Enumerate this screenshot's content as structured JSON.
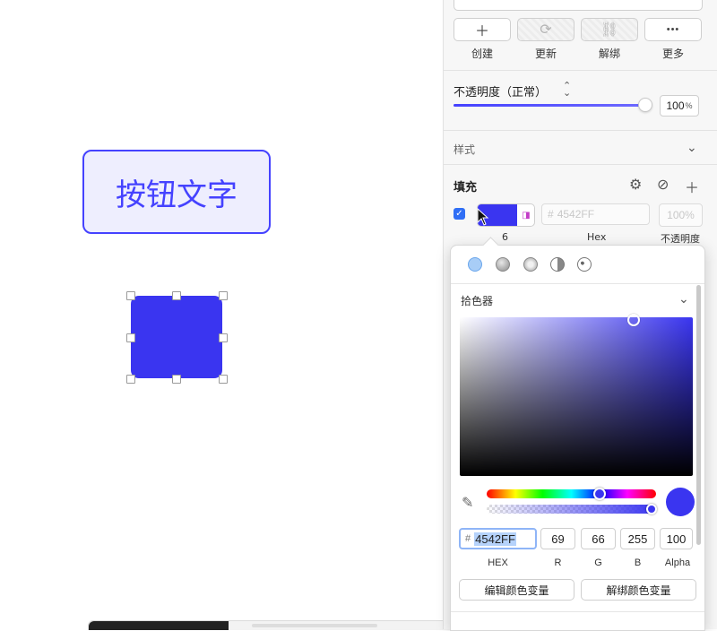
{
  "canvas": {
    "button_text": "按钮文字"
  },
  "panel": {
    "actions": [
      {
        "icon": "＋",
        "label": "创建"
      },
      {
        "icon": "⟳",
        "label": "更新"
      },
      {
        "icon": "⛓",
        "label": "解绑"
      },
      {
        "icon": "•••",
        "label": "更多"
      }
    ],
    "opacity": {
      "label": "不透明度（正常）",
      "value": "100",
      "unit": "%"
    },
    "style_label": "样式",
    "fill": {
      "label": "填充",
      "hex_placeholder": "4542FF",
      "opacity_placeholder": "100%",
      "under_labels": [
        "6",
        "Hex",
        "不透明度"
      ]
    }
  },
  "picker": {
    "title": "拾色器",
    "hex": "4542FF",
    "r": "69",
    "g": "66",
    "b": "255",
    "alpha": "100",
    "labels": {
      "hex": "HEX",
      "r": "R",
      "g": "G",
      "b": "B",
      "alpha": "Alpha"
    },
    "buttons": {
      "edit": "编辑颜色变量",
      "unbind": "解绑颜色变量"
    }
  },
  "colors": {
    "accent": "#4542FF",
    "fill": "#3A35F0",
    "button_bg": "#EEEEFE",
    "checkbox": "#2F6EF5"
  }
}
